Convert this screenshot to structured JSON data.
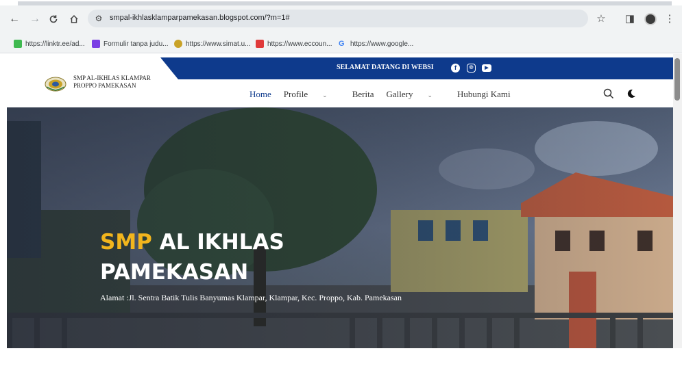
{
  "browser": {
    "url": "smpal-ikhlasklamparpamekasan.blogspot.com/?m=1#",
    "bookmarks": [
      {
        "label": "https://linktr.ee/ad...",
        "color": "#3fb950"
      },
      {
        "label": "Formulir tanpa judu...",
        "color": "#7b3fe4"
      },
      {
        "label": "https://www.simat.u...",
        "color": "#c9a227"
      },
      {
        "label": "https://www.eccoun...",
        "color": "#e03a3a"
      },
      {
        "label": "https://www.google...",
        "color": "#4285f4"
      }
    ]
  },
  "site": {
    "welcome": "SELAMAT DATANG DI WEBSI",
    "school_name_line1": "SMP AL-IKHLAS KLAMPAR",
    "school_name_line2": "PROPPO PAMEKASAN",
    "menu": {
      "home": "Home",
      "profile": "Profile",
      "berita": "Berita",
      "gallery": "Gallery",
      "hubungi": "Hubungi Kami"
    },
    "hero": {
      "title_accent": "SMP",
      "title_rest": "AL IKHLAS",
      "title_line2": "PAMEKASAN",
      "address": "Alamat :Jl. Sentra Batik Tulis Banyumas Klampar, Klampar, Kec. Proppo, Kab. Pamekasan"
    },
    "colors": {
      "brand_blue": "#0e3a8c",
      "accent_yellow": "#f2b51d"
    }
  }
}
